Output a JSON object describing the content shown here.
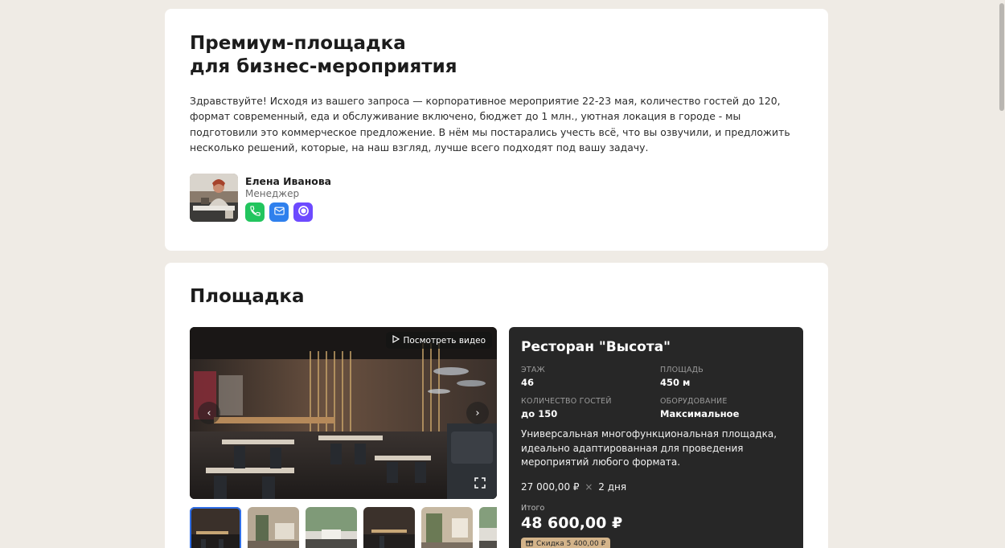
{
  "intro": {
    "title_line1": "Премиум-площадка",
    "title_line2": "для бизнес-мероприятия",
    "greeting": "Здравствуйте! Исходя из вашего запроса — корпоративное мероприятие 22-23 мая, количество гостей до 120, формат современный, еда и обслуживание включено, бюджет до 1 млн., уютная локация в городе  - мы подготовили это коммерческое предложение. В нём мы постарались учесть всё, что вы озвучили, и предложить несколько решений, которые, на наш взгляд, лучше всего подходят под вашу задачу.",
    "manager": {
      "name": "Елена Иванова",
      "role": "Менеджер",
      "contacts": [
        {
          "icon": "phone-icon",
          "color": "#22c55e"
        },
        {
          "icon": "mail-icon",
          "color": "#2f80ed"
        },
        {
          "icon": "messenger-icon",
          "color": "#6d4aff"
        }
      ]
    }
  },
  "venue_section": {
    "title": "Площадка",
    "gallery": {
      "video_label": "Посмотреть видео",
      "thumbnail_count": 6,
      "active_thumbnail": 1
    },
    "venue": {
      "name": "Ресторан \"Высота\"",
      "specs": [
        {
          "label": "ЭТАЖ",
          "value": "46"
        },
        {
          "label": "ПЛОЩАДЬ",
          "value": "450 м"
        },
        {
          "label": "КОЛИЧЕСТВО ГОСТЕЙ",
          "value": "до 150"
        },
        {
          "label": "ОБОРУДОВАНИЕ",
          "value": "Максимальное"
        }
      ],
      "description": "Универсальная многофункциональная площадка, идеально адаптированная для проведения мероприятий любого формата.",
      "price_per_day": "27 000,00 ₽",
      "multiply_sign": "×",
      "days": "2 дня",
      "total_label": "Итого",
      "total_value": "48 600,00 ₽",
      "discount": "Скидка 5 400,00 ₽"
    }
  },
  "colors": {
    "page_bg": "#efebe5",
    "panel_dark": "#272727",
    "discount_badge": "#d4b48a",
    "active_thumb_border": "#2f6ee6"
  }
}
